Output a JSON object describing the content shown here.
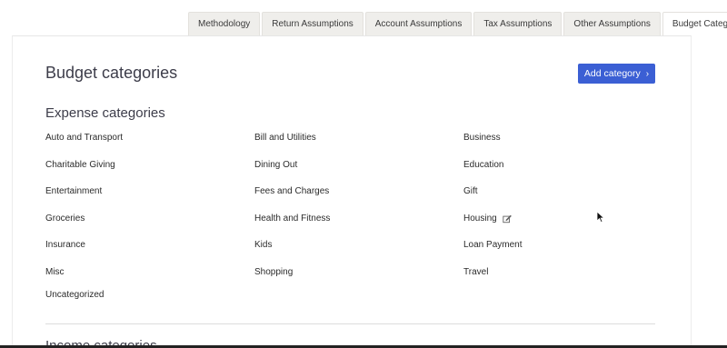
{
  "tabs": [
    {
      "label": "Methodology",
      "active": false
    },
    {
      "label": "Return Assumptions",
      "active": false
    },
    {
      "label": "Account Assumptions",
      "active": false
    },
    {
      "label": "Tax Assumptions",
      "active": false
    },
    {
      "label": "Other Assumptions",
      "active": false
    },
    {
      "label": "Budget Categories",
      "active": true
    }
  ],
  "page": {
    "title": "Budget categories",
    "add_button_label": "Add category",
    "add_button_icon": "chevron-right-icon"
  },
  "expense": {
    "title": "Expense categories",
    "categories": [
      "Auto and Transport",
      "Bill and Utilities",
      "Business",
      "Charitable Giving",
      "Dining Out",
      "Education",
      "Entertainment",
      "Fees and Charges",
      "Gift",
      "Groceries",
      "Health and Fitness",
      "Housing",
      "Insurance",
      "Kids",
      "Loan Payment",
      "Misc",
      "Shopping",
      "Travel",
      "Uncategorized"
    ],
    "hovered_item": "Housing",
    "hover_icon": "edit-icon"
  },
  "income": {
    "title": "Income categories"
  },
  "colors": {
    "accent": "#3b5fd4",
    "tab_bg": "#efeeeb",
    "text": "#2b2b2b"
  }
}
